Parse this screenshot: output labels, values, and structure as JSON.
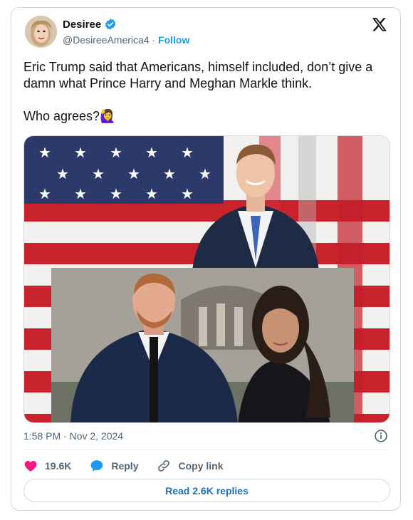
{
  "author": {
    "name": "Desiree",
    "handle": "@DesireeAmerica4",
    "separator": "·",
    "follow_label": "Follow",
    "verified": true
  },
  "tweet": {
    "paragraph1": "Eric Trump said that Americans, himself included, don’t give a damn what Prince Harry and Meghan Markle think.",
    "paragraph2": "Who agrees?",
    "emoji": "🙋‍♀️",
    "timestamp": "1:58 PM · Nov 2, 2024"
  },
  "actions": {
    "likes": "19.6K",
    "reply_label": "Reply",
    "copy_link_label": "Copy link",
    "read_replies_label": "Read 2.6K replies"
  },
  "colors": {
    "accent": "#1d9bf0",
    "like": "#f91880",
    "text": "#0f1419",
    "muted": "#536471"
  },
  "icons": [
    "verified-badge-icon",
    "x-logo-icon",
    "info-icon",
    "heart-icon",
    "reply-bubble-icon",
    "link-icon"
  ]
}
